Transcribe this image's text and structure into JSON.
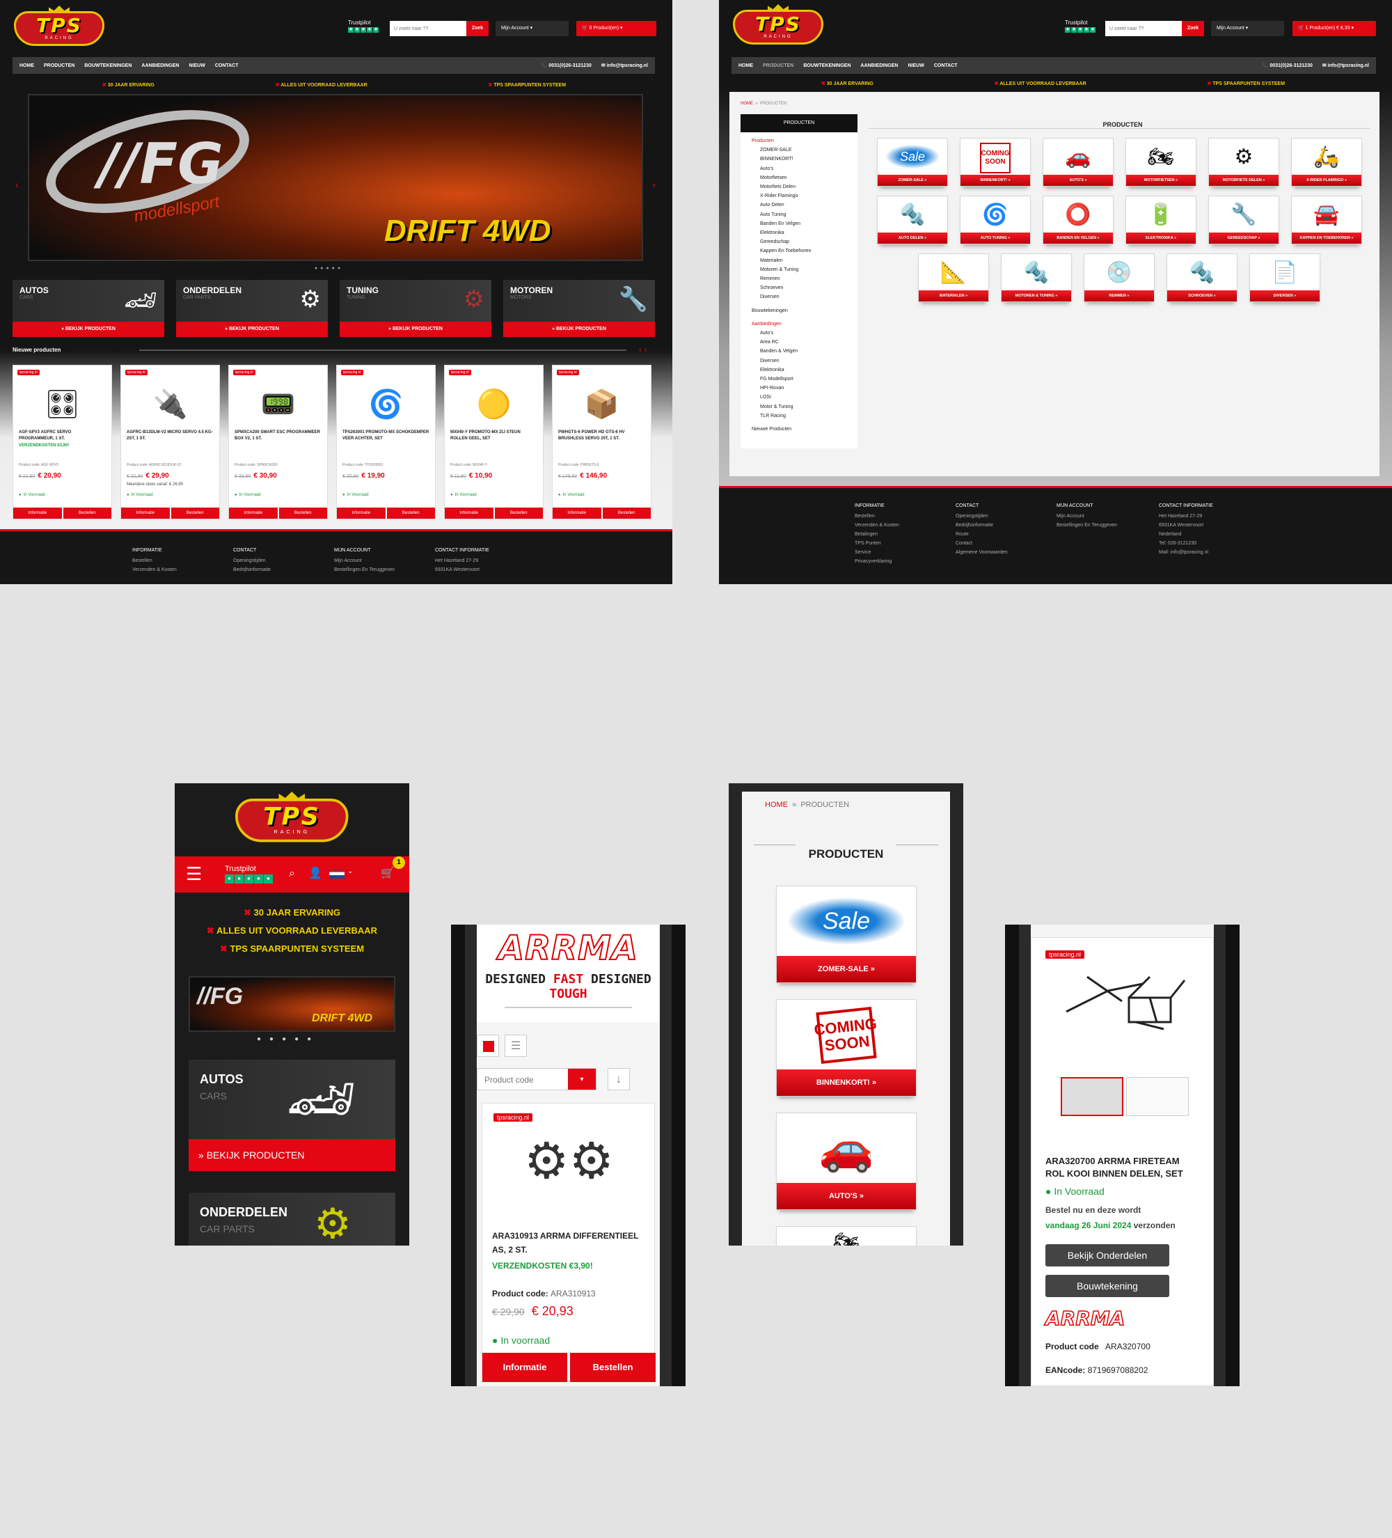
{
  "desktop_home": {
    "search_placeholder": "U zoekt naar ??",
    "search_btn": "Zoek",
    "account": "Mijn Account",
    "cart": "0 Product(en)",
    "trustpilot": "Trustpilot",
    "nav": [
      "HOME",
      "PRODUCTEN",
      "BOUWTEKENINGEN",
      "AANBIEDINGEN",
      "NIEUW",
      "CONTACT"
    ],
    "phone": "0031(0)26-3121230",
    "email": "info@tpsracing.nl",
    "usps": [
      "30 JAAR ERVARING",
      "ALLES UIT VOORRAAD LEVERBAAR",
      "TPS SPAARPUNTEN SYSTEEM"
    ],
    "hero_brand": "modellsport",
    "hero_badge": "DRIFT 4WD",
    "cats": [
      {
        "t": "AUTOS",
        "s": "CARS"
      },
      {
        "t": "ONDERDELEN",
        "s": "CAR PARTS"
      },
      {
        "t": "TUNING",
        "s": "TUNING"
      },
      {
        "t": "MOTOREN",
        "s": "MOTORS"
      }
    ],
    "cat_btn": "BEKIJK PRODUCTEN",
    "new_title": "Nieuwe producten",
    "products": [
      {
        "name": "AGF-SPV3 AGFRC SERVO PROGRAMMEUR, 1 ST.",
        "ship": "VERZENDKOSTEN €3,90!",
        "code": "Product code: AGF-SPV3",
        "old": "€ 21,90",
        "price": "€ 20,90",
        "stock": "In Voorraad"
      },
      {
        "name": "AGFRC-B13DLM-V2 MICRO SERVO 4.5 KG-2ST, 1 ST.",
        "ship": "",
        "code": "Product code: AGFRC-B13DLM-V2",
        "old": "€ 32,90",
        "price": "€ 29,90",
        "extra": "Meerdere stuks vanaf: € 26,90",
        "stock": "In Voorraad"
      },
      {
        "name": "SPMXCA200 SMART ESC PROGRAMMEER BOX V2, 1 ST.",
        "ship": "",
        "code": "Product code: SPMXCA200",
        "old": "€ 33,90",
        "price": "€ 30,90",
        "stock": "In Voorraad"
      },
      {
        "name": "TPS263001 PROMOTO-MX SCHOKDEMPER VEER ACHTER, SET",
        "ship": "",
        "code": "Product code: TPS263001",
        "old": "€ 20,90",
        "price": "€ 19,90",
        "stock": "In Voorraad"
      },
      {
        "name": "MX040-Y PROMOTO-MX ZIJ STEUN ROLLEN GEEL, SET",
        "ship": "",
        "code": "Product code: MX040-Y",
        "old": "€ 11,90",
        "price": "€ 10,90",
        "stock": "In Voorraad"
      },
      {
        "name": "PWHGTS-6 POWER HD GTS-6 HV BRUSHLESS SERVO 25T, 1 ST.",
        "ship": "",
        "code": "Product code: PWHGTS-6",
        "old": "€ 149,50",
        "price": "€ 146,90",
        "stock": "In Voorraad"
      }
    ],
    "btn_info": "Informatie",
    "btn_buy": "Bestellen",
    "prod_label": "tpsracing.nl",
    "footer": [
      {
        "h": "INFORMATIE",
        "items": [
          "Bestellen",
          "Verzenden & Kosten"
        ]
      },
      {
        "h": "CONTACT",
        "items": [
          "Openingstijden",
          "Bedrijfsinformatie"
        ]
      },
      {
        "h": "MIJN ACCOUNT",
        "items": [
          "Mijn Account",
          "Bestellingen En Teruggeven"
        ]
      },
      {
        "h": "CONTACT INFORMATIE",
        "items": [
          "Het Hazeland 27-29",
          "6931KA Westervoort"
        ]
      }
    ]
  },
  "desktop_products": {
    "cart": "1 Product(en) € 8,33",
    "breadcrumb": [
      "HOME",
      "PRODUCTEN"
    ],
    "side_title": "PRODUCTEN",
    "page_title": "PRODUCTEN",
    "tree": [
      "Producten",
      "ZOMER-SALE",
      "BINNENKORT!",
      "Auto's",
      "Motorfietsen",
      "Motorfiets Delen",
      "X-Rider Flamingo",
      "Auto Delen",
      "Auto Tuning",
      "Banden En Velgen",
      "Elektronika",
      "Gereedschap",
      "Kappen En Toebehoren",
      "Materialen",
      "Motoren & Tuning",
      "Remmen",
      "Schroeven",
      "Diversen"
    ],
    "tree2": [
      "Bouwtekeningen"
    ],
    "tree3": [
      "Aanbiedingen",
      "Auto's",
      "Area RC",
      "Banden & Velgen",
      "Diversen",
      "Elektronika",
      "FG Modellsport",
      "HPI-Rovan",
      "LOSI",
      "Motor & Tuning",
      "TLR Racing"
    ],
    "tree4": [
      "Nieuwe Producten"
    ],
    "tiles": [
      "ZOMER-SALE",
      "BINNENKORT!",
      "AUTO'S",
      "MOTORFIETSEN",
      "MOTORFIETS DELEN",
      "X-RIDER FLAMINGO",
      "AUTO DELEN",
      "AUTO TUNING",
      "BANDEN EN VELGEN",
      "ELEKTRONIKA",
      "GEREEDSCHAP",
      "KAPPEN EN TOEBEHOREN",
      "MATERIALEN",
      "MOTOREN & TUNING",
      "REMMEN",
      "SCHROEVEN",
      "DIVERSEN"
    ],
    "sale_text": "Sale",
    "soon_text": "COMING SOON",
    "footer": [
      {
        "h": "INFORMATIE",
        "items": [
          "Bestellen",
          "Verzenden & Kosten",
          "Betalingen",
          "TPS Punten",
          "Service",
          "Privacyverklaring"
        ]
      },
      {
        "h": "CONTACT",
        "items": [
          "Openingstijden",
          "Bedrijfsinformatie",
          "Route",
          "Contact",
          "Algemene Voorwaarden"
        ]
      },
      {
        "h": "MIJN ACCOUNT",
        "items": [
          "Mijn Account",
          "Bestellingen En Teruggeven"
        ]
      },
      {
        "h": "CONTACT INFORMATIE",
        "items": [
          "Het Hazeland 27-29",
          "6931KA Westervoort",
          "Nederland",
          "Tel: 026-3121230",
          "Mail: info@tpsracing.nl"
        ]
      }
    ]
  },
  "mobile_home": {
    "trustpilot": "Trustpilot",
    "cart_count": "1",
    "usps": [
      "30 JAAR ERVARING",
      "ALLES UIT VOORRAAD LEVERBAAR",
      "TPS SPAARPUNTEN SYSTEEM"
    ],
    "cat1": "AUTOS",
    "cat1_sub": "CARS",
    "cat_btn": "BEKIJK PRODUCTEN",
    "cat2": "ONDERDELEN",
    "cat2_sub": "CAR PARTS"
  },
  "mobile_arrma": {
    "brand": "ARRMA",
    "tagline_1": "DESIGNED ",
    "tagline_2": "FAST ",
    "tagline_3": "DESIGNED ",
    "tagline_4": "TOUGH",
    "sort": "Product code",
    "label": "tpsracing.nl",
    "name": "ARA310913 ARRMA DIFFERENTIEEL AS, 2 ST.",
    "ship": "VERZENDKOSTEN €3,90!",
    "code_label": "Product code:",
    "code": "ARA310913",
    "old": "€ 29,90",
    "price": "€ 20,93",
    "stock": "In voorraad",
    "btn_info": "Informatie",
    "btn_buy": "Bestellen"
  },
  "mobile_products": {
    "breadcrumb_home": "HOME",
    "breadcrumb_cur": "PRODUCTEN",
    "title": "PRODUCTEN",
    "tiles": [
      "ZOMER-SALE",
      "BINNENKORT!",
      "AUTO'S"
    ],
    "sale_text": "Sale",
    "soon_text": "COMING SOON"
  },
  "mobile_detail": {
    "label": "tpsracing.nl",
    "name": "ARA320700 ARRMA FIRETEAM ROL KOOI BINNEN DELEN, SET",
    "stock": "In Voorraad",
    "order_text": "Bestel nu en deze wordt",
    "order_date": "vandaag 26 Juni 2024",
    "order_tail": " verzonden",
    "btn1": "Bekijk Onderdelen",
    "btn2": "Bouwtekening",
    "brand": "ARRMA",
    "code_label": "Product code",
    "code": "ARA320700",
    "ean_label": "EANcode:",
    "ean": "8719697088202"
  },
  "colors": {
    "accent": "#e30613",
    "yellow": "#f0d000",
    "green": "#1a9c3a",
    "dark": "#151515"
  }
}
